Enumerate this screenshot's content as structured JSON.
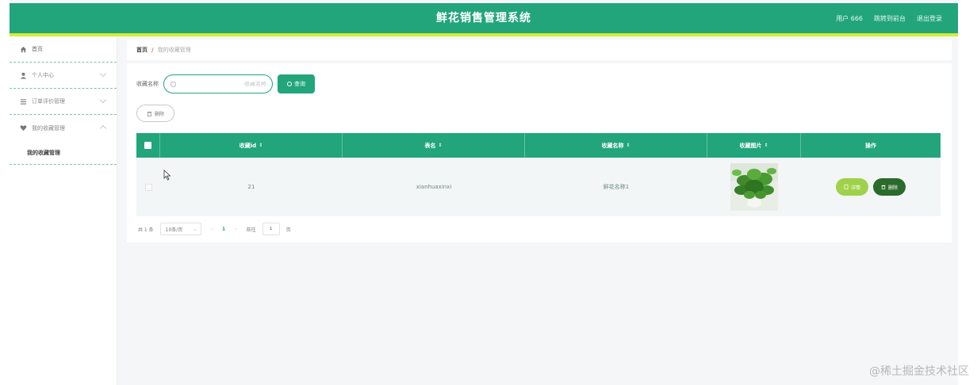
{
  "header": {
    "title": "鲜花销售管理系统",
    "user_label": "用户 666",
    "back_to_front": "跳转到前台",
    "logout": "退出登录",
    "bar_color": "#22a57a",
    "accent_color": "#d8ec3a"
  },
  "sidebar": {
    "items": [
      {
        "label": "首页",
        "icon": "home-icon"
      },
      {
        "label": "个人中心",
        "icon": "user-icon"
      },
      {
        "label": "订单评价管理",
        "icon": "list-icon"
      },
      {
        "label": "我的收藏管理",
        "icon": "heart-icon"
      }
    ],
    "sub_item": "我的收藏管理"
  },
  "breadcrumb": {
    "home": "首页",
    "separator": "/",
    "current": "我的收藏管理"
  },
  "search": {
    "label": "收藏名称",
    "placeholder": "收藏名称",
    "query_button": "查询",
    "delete_button": "删除"
  },
  "table": {
    "columns": [
      "收藏id",
      "表名",
      "收藏名称",
      "收藏图片",
      "操作"
    ],
    "rows": [
      {
        "id": "21",
        "table_name": "xianhuaxinxi",
        "fav_name": "鲜花名称1",
        "image": "potted-plant"
      }
    ],
    "detail_button": "详情",
    "remove_button": "删除"
  },
  "pager": {
    "total": "共 1 条",
    "page_size": "10条/页",
    "current_page": "1",
    "goto_label": "前往",
    "goto_value": "1",
    "page_suffix": "页"
  },
  "watermark": "@稀土掘金技术社区"
}
